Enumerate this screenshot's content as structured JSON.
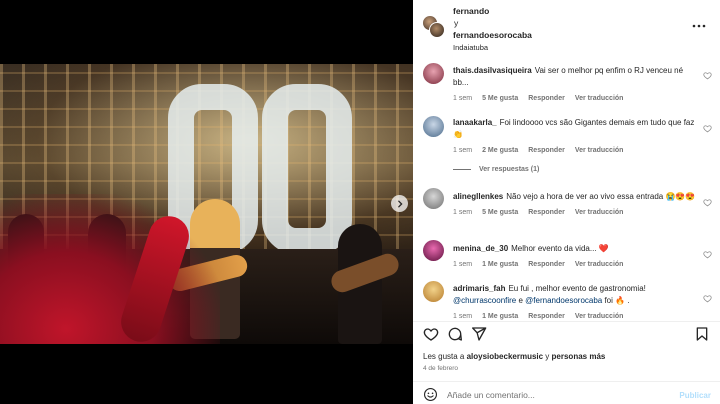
{
  "post": {
    "authors": [
      "fernando",
      "fernandoesorocaba"
    ],
    "conjunction": "y",
    "location": "Indaiatuba"
  },
  "media": {
    "carousel_count": 8,
    "carousel_active": 1
  },
  "comments": [
    {
      "user": "thais.dasilvasiqueira",
      "text": "Vai ser o melhor pq enfim o RJ venceu né bb...",
      "time": "1 sem",
      "likes": "5 Me gusta",
      "reply": "Responder",
      "translate": "Ver traducción"
    },
    {
      "user": "lanaakarla_",
      "text": "Foi lindoooo vcs são Gigantes demais em tudo que faz👏",
      "time": "1 sem",
      "likes": "2 Me gusta",
      "reply": "Responder",
      "translate": "Ver traducción",
      "replies_label": "Ver respuestas (1)"
    },
    {
      "user": "alinegllenkes",
      "text": "Não vejo a hora de ver ao vivo essa entrada 😭😍😍",
      "time": "1 sem",
      "likes": "5 Me gusta",
      "reply": "Responder",
      "translate": "Ver traducción"
    },
    {
      "user": "menina_de_30",
      "text": "Melhor evento da vida... ❤️",
      "time": "1 sem",
      "likes": "1 Me gusta",
      "reply": "Responder",
      "translate": "Ver traducción"
    },
    {
      "user": "adrimaris_fah",
      "text": "Eu fui , melhor evento de gastronomia!",
      "mention1": "@churrascoonfire",
      "mid": " e ",
      "mention2": "@fernandoesorocaba",
      "tail": " foi 🔥 .",
      "time": "1 sem",
      "likes": "1 Me gusta",
      "reply": "Responder",
      "translate": "Ver traducción"
    }
  ],
  "likes_line": {
    "prefix": "Les gusta a ",
    "user": "aloysiobeckermusic",
    "mid": " y ",
    "others": "personas más"
  },
  "date": "4 de febrero",
  "add_comment": {
    "placeholder": "Añade un comentario...",
    "publish": "Publicar"
  },
  "icons": [
    "more-icon",
    "heart-icon",
    "comment-icon",
    "share-icon",
    "bookmark-icon",
    "emoji-icon",
    "chevron-right-icon",
    "user-tag-icon"
  ]
}
